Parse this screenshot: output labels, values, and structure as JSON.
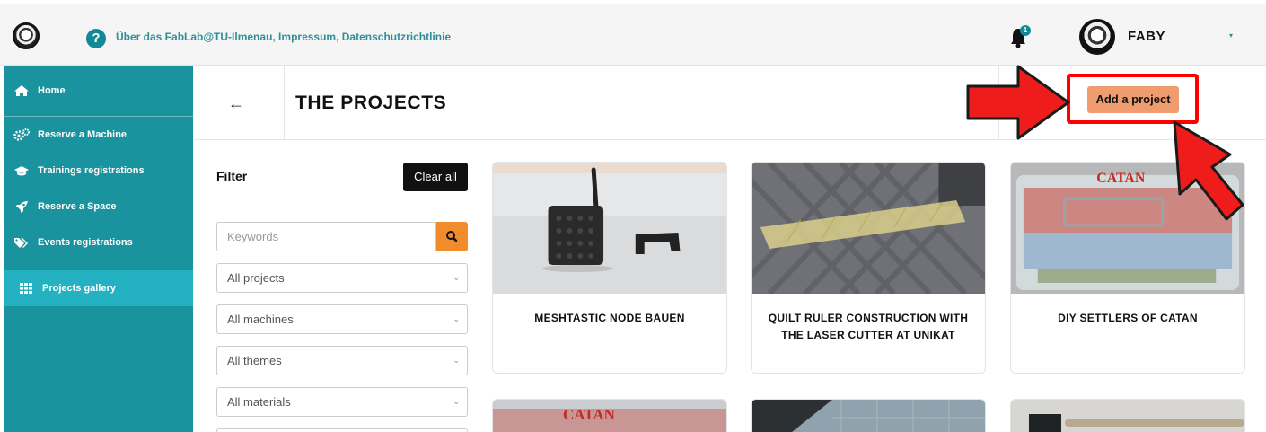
{
  "topbar": {
    "link_text": "Über das FabLab@TU-Ilmenau, Impressum, Datenschutzrichtlinie",
    "help_glyph": "?",
    "notification_count": "1",
    "username": "FABY",
    "user_menu_chevron": "▾"
  },
  "sidebar": {
    "items": [
      {
        "label": "Home",
        "icon": "home-icon"
      },
      {
        "label": "Reserve a Machine",
        "icon": "gears-icon"
      },
      {
        "label": "Trainings registrations",
        "icon": "graduation-cap-icon"
      },
      {
        "label": "Reserve a Space",
        "icon": "rocket-icon"
      },
      {
        "label": "Events registrations",
        "icon": "tags-icon"
      },
      {
        "label": "Projects gallery",
        "icon": "grid-icon",
        "active": true
      }
    ]
  },
  "header": {
    "back_glyph": "←",
    "title": "THE PROJECTS",
    "add_button_label": "Add a project"
  },
  "filter": {
    "title": "Filter",
    "clear_label": "Clear all",
    "keywords_placeholder": "Keywords",
    "selects": [
      "All projects",
      "All machines",
      "All themes",
      "All materials"
    ]
  },
  "projects": [
    {
      "title": "MESHTASTIC NODE BAUEN"
    },
    {
      "title": "QUILT RULER CONSTRUCTION WITH THE LASER CUTTER AT UNIKAT"
    },
    {
      "title": "DIY SETTLERS OF CATAN"
    }
  ],
  "image_text": {
    "catan": "CATAN"
  },
  "colors": {
    "sidebar": "#19939e",
    "sidebar_active": "#24b2c2",
    "add_button": "#ef9d6f",
    "highlight": "#ff0000",
    "search_button": "#f28b2c"
  }
}
